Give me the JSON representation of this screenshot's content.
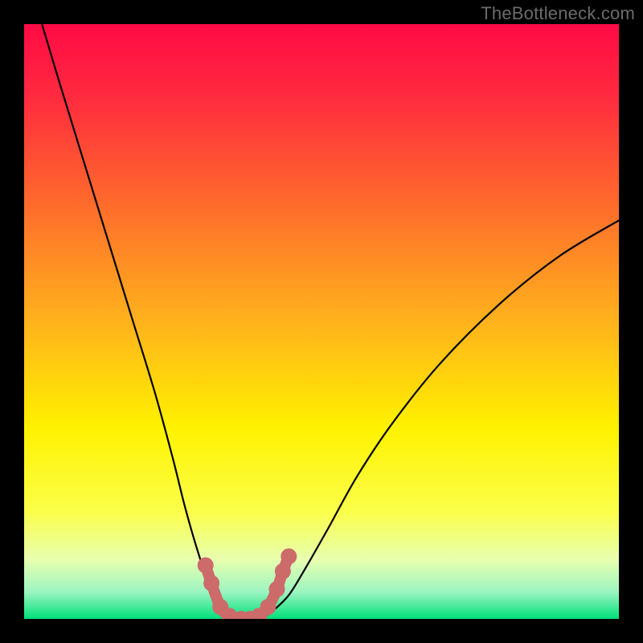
{
  "watermark": "TheBottleneck.com",
  "chart_data": {
    "type": "line",
    "title": "",
    "xlabel": "",
    "ylabel": "",
    "xlim": [
      0,
      100
    ],
    "ylim": [
      0,
      100
    ],
    "background_gradient_stops": [
      {
        "pos": 0.0,
        "color": "#ff0a45"
      },
      {
        "pos": 0.12,
        "color": "#ff2a3f"
      },
      {
        "pos": 0.3,
        "color": "#ff6a2c"
      },
      {
        "pos": 0.5,
        "color": "#ffb21c"
      },
      {
        "pos": 0.68,
        "color": "#fff200"
      },
      {
        "pos": 0.82,
        "color": "#fbff4a"
      },
      {
        "pos": 0.9,
        "color": "#e8ffb0"
      },
      {
        "pos": 0.955,
        "color": "#9bf5c0"
      },
      {
        "pos": 1.0,
        "color": "#00e07a"
      }
    ],
    "series": [
      {
        "name": "left-curve",
        "color": "#000000",
        "x": [
          3,
          6,
          10,
          14,
          18,
          22,
          25,
          27,
          29,
          31,
          32.5,
          34,
          35.5
        ],
        "y": [
          100,
          90,
          77,
          64,
          51,
          38,
          27,
          19,
          12,
          6,
          3,
          1,
          0
        ]
      },
      {
        "name": "right-curve",
        "color": "#000000",
        "x": [
          40,
          42,
          44.5,
          47,
          51,
          56,
          62,
          70,
          80,
          90,
          100
        ],
        "y": [
          0,
          1.5,
          4,
          8,
          15,
          24,
          33,
          43,
          53,
          61,
          67
        ]
      },
      {
        "name": "valley-highlight",
        "color": "#cd6a6a",
        "type": "scatter",
        "x": [
          30.5,
          31.5,
          33,
          34.5,
          36.5,
          38,
          39.5,
          41,
          42.5,
          43.5,
          44.5
        ],
        "y": [
          9,
          6,
          2,
          0.5,
          0,
          0,
          0.5,
          2,
          5,
          8,
          10.5
        ]
      }
    ]
  }
}
